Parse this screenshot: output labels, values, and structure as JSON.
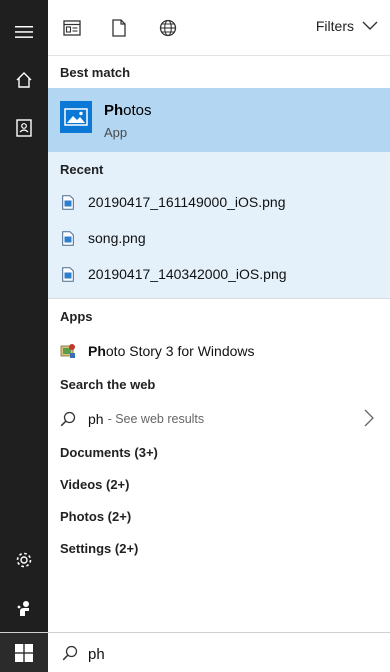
{
  "toolbar": {
    "filters_label": "Filters"
  },
  "best_match": {
    "header": "Best match",
    "app_name_prefix": "Ph",
    "app_name_rest": "otos",
    "app_type": "App"
  },
  "recent": {
    "header": "Recent",
    "items": [
      {
        "name": "20190417_161149000_iOS.png"
      },
      {
        "name": "song.png"
      },
      {
        "name": "20190417_140342000_iOS.png"
      }
    ]
  },
  "apps": {
    "header": "Apps",
    "items": [
      {
        "name_prefix": "Ph",
        "name_rest": "oto Story 3 for Windows"
      }
    ]
  },
  "web": {
    "header": "Search the web",
    "query": "ph",
    "hint": "- See web results"
  },
  "categories": [
    {
      "label": "Documents (3+)"
    },
    {
      "label": "Videos (2+)"
    },
    {
      "label": "Photos (2+)"
    },
    {
      "label": "Settings (2+)"
    }
  ],
  "search": {
    "value": "ph"
  },
  "colors": {
    "rail": "#1f1f1f",
    "best_match_bg": "#b3d6f2",
    "recent_bg": "#e4f0fa",
    "accent": "#0a78d4"
  }
}
